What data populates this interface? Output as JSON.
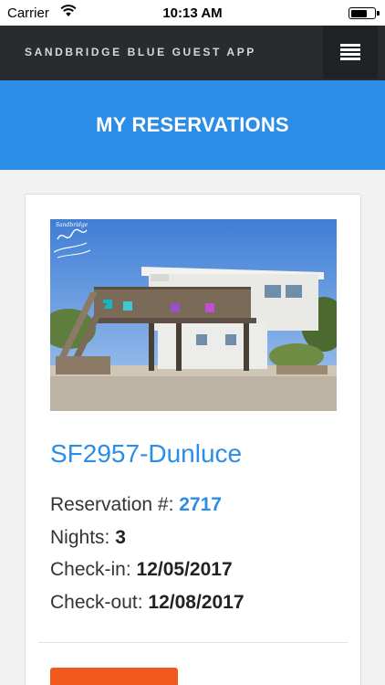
{
  "status_bar": {
    "carrier": "Carrier",
    "time": "10:13 AM",
    "icons": [
      "wifi-icon",
      "battery-icon"
    ]
  },
  "header": {
    "app_title": "SANDBRIDGE BLUE GUEST APP",
    "menu_icon": "hamburger-menu-icon"
  },
  "page": {
    "title": "MY RESERVATIONS"
  },
  "reservation": {
    "photo_logo_text": "Sandbridge",
    "property_name": "SF2957-Dunluce",
    "reservation_label": "Reservation #: ",
    "reservation_number": "2717",
    "nights_label": "Nights: ",
    "nights": "3",
    "checkin_label": "Check-in: ",
    "checkin": "12/05/2017",
    "checkout_label": "Check-out: ",
    "checkout": "12/08/2017"
  },
  "colors": {
    "accent_blue": "#2b8de6",
    "header_dark": "#292c2e",
    "action_orange": "#f25a1d"
  }
}
